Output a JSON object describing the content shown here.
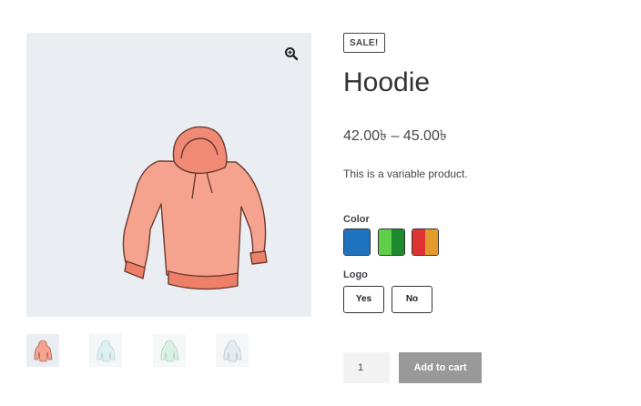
{
  "product": {
    "sale_badge": "SALE!",
    "title": "Hoodie",
    "price": "42.00৳ – 45.00৳",
    "description": "This is a variable product."
  },
  "gallery": {
    "zoom_icon": "zoom-in-icon",
    "main_image": "hoodie-pink-image",
    "thumbnails": [
      "hoodie-pink",
      "hoodie-blue-logo",
      "hoodie-green",
      "hoodie-gray"
    ]
  },
  "variations": {
    "color_label": "Color",
    "colors": [
      {
        "name": "blue",
        "hex": [
          "#1e73be"
        ]
      },
      {
        "name": "green",
        "hex": [
          "#5fcf4a",
          "#1e8a2e"
        ]
      },
      {
        "name": "red-orange",
        "hex": [
          "#dd3333",
          "#e39b2e"
        ]
      }
    ],
    "logo_label": "Logo",
    "logo_options": [
      "Yes",
      "No"
    ]
  },
  "cart": {
    "quantity": "1",
    "add_label": "Add to cart"
  }
}
